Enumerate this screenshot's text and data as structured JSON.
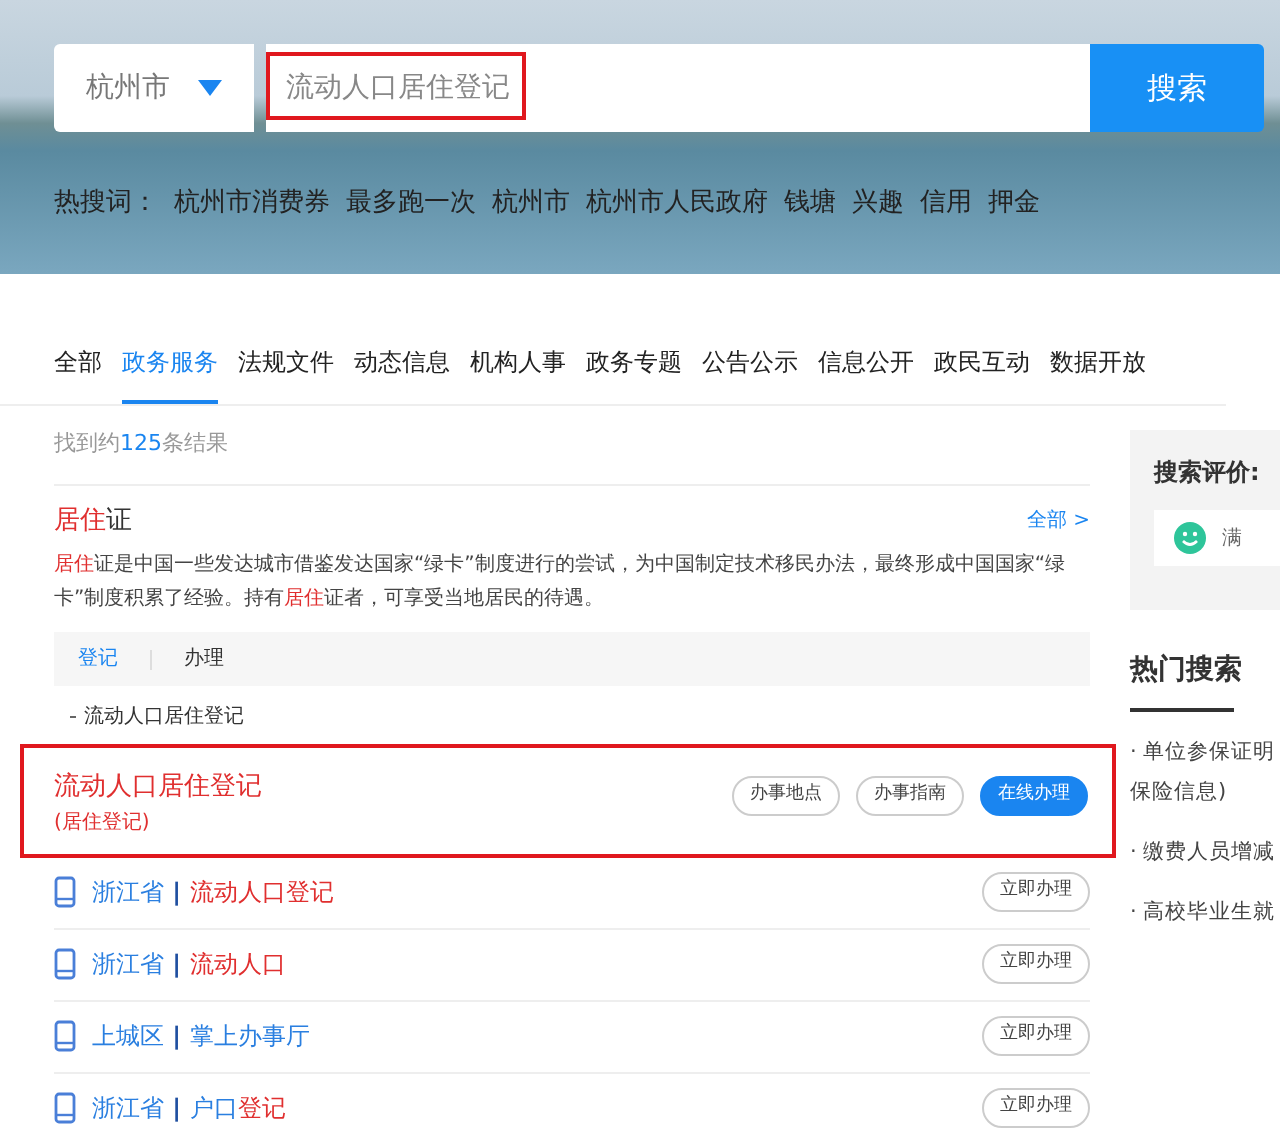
{
  "search": {
    "city": "杭州市",
    "placeholder": "流动人口居住登记",
    "highlighted": true,
    "button": "搜索"
  },
  "hot_words": {
    "label": "热搜词：",
    "items": [
      "杭州市消费券",
      "最多跑一次",
      "杭州市",
      "杭州市人民政府",
      "钱塘",
      "兴趣",
      "信用",
      "押金"
    ]
  },
  "tabs": [
    {
      "label": "全部",
      "selected": false
    },
    {
      "label": "政务服务",
      "selected": true
    },
    {
      "label": "法规文件",
      "selected": false
    },
    {
      "label": "动态信息",
      "selected": false
    },
    {
      "label": "机构人事",
      "selected": false
    },
    {
      "label": "政务专题",
      "selected": false
    },
    {
      "label": "公告公示",
      "selected": false
    },
    {
      "label": "信息公开",
      "selected": false
    },
    {
      "label": "政民互动",
      "selected": false
    },
    {
      "label": "数据开放",
      "selected": false
    }
  ],
  "result_count": [
    {
      "text": "找到约",
      "hl": false
    },
    {
      "text": "125",
      "hl": true
    },
    {
      "text": "条结果",
      "hl": false
    }
  ],
  "topic": {
    "title": [
      {
        "text": "居住",
        "hl": true
      },
      {
        "text": "证",
        "hl": false
      }
    ],
    "more": "全部 >",
    "description": [
      {
        "text": "居住",
        "hl": true
      },
      {
        "text": "证是中国一些发达城市借鉴发达国家“绿卡”制度进行的尝试，为中国制定技术移民办法，最终形成中国国家“绿卡”制度积累了经验。持有",
        "hl": false
      },
      {
        "text": "居住",
        "hl": true
      },
      {
        "text": "证者，可享受当地居民的待遇。",
        "hl": false
      }
    ],
    "subtabs": [
      {
        "label": "登记",
        "selected": true
      },
      {
        "label": "办理",
        "selected": false
      }
    ],
    "subitems": [
      "流动人口居住登记"
    ]
  },
  "featured": {
    "title": "流动人口居住登记",
    "subtitle": "(居住登记)",
    "highlighted": true,
    "buttons": [
      {
        "label": "办事地点",
        "kind": "outline"
      },
      {
        "label": "办事指南",
        "kind": "outline"
      },
      {
        "label": "在线办理",
        "kind": "primary"
      }
    ]
  },
  "results": [
    {
      "title": [
        {
          "text": "浙江省",
          "hl": false
        },
        {
          "text": " | ",
          "hl": false
        },
        {
          "text": "流动人口登记",
          "hl": true
        }
      ],
      "button": "立即办理"
    },
    {
      "title": [
        {
          "text": "浙江省",
          "hl": false
        },
        {
          "text": " | ",
          "hl": false
        },
        {
          "text": "流动人口",
          "hl": true
        }
      ],
      "button": "立即办理"
    },
    {
      "title": [
        {
          "text": "上城区",
          "hl": false
        },
        {
          "text": " | ",
          "hl": false
        },
        {
          "text": "掌上办事厅",
          "hl": false
        }
      ],
      "button": "立即办理"
    },
    {
      "title": [
        {
          "text": "浙江省",
          "hl": false
        },
        {
          "text": " | ",
          "hl": false
        },
        {
          "text": "户口",
          "hl": false
        },
        {
          "text": "登记",
          "hl": true
        }
      ],
      "button": "立即办理"
    }
  ],
  "sidebar": {
    "rating_title": "搜索评价:",
    "rating_option": "满",
    "hot_title": "热门搜索",
    "hot_items": [
      "· 单位参保证明保险信息)",
      "· 缴费人员增减",
      "· 高校毕业生就"
    ]
  }
}
